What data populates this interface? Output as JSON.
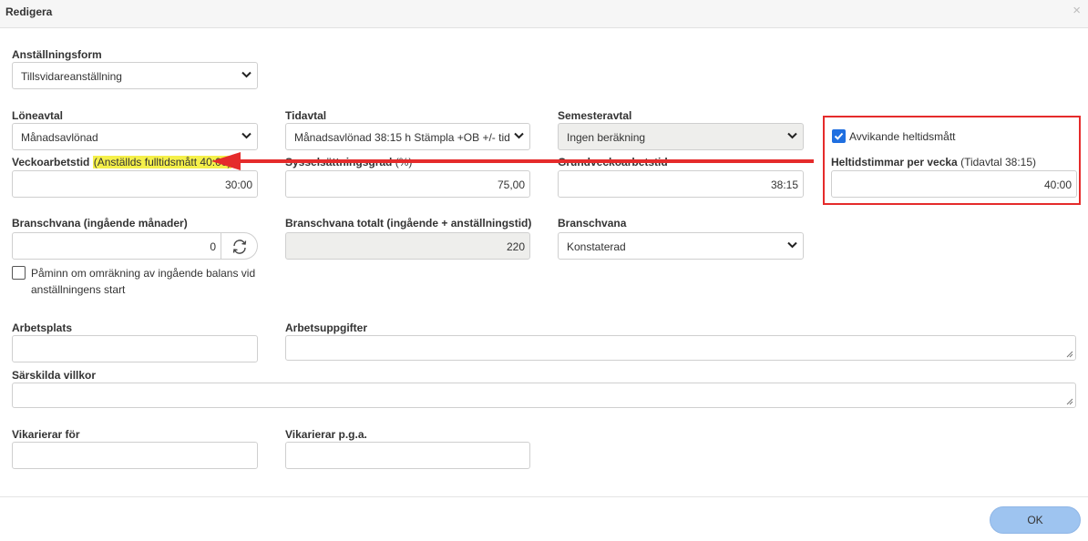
{
  "dialog": {
    "title": "Redigera",
    "close_icon": "×"
  },
  "employment_form": {
    "label": "Anställningsform",
    "value": "Tillsvidareanställning"
  },
  "salary_agreement": {
    "label": "Löneavtal",
    "value": "Månadsavlönad"
  },
  "time_agreement": {
    "label": "Tidavtal",
    "value": "Månadsavlönad 38:15 h Stämpla +OB +/- tid"
  },
  "vacation_agreement": {
    "label": "Semesteravtal",
    "value": "Ingen beräkning"
  },
  "weekly_hours": {
    "label": "Veckoarbetstid",
    "highlight": "(Anställds fulltidsmått 40:00)",
    "value": "30:00"
  },
  "employment_rate": {
    "label": "Sysselsättningsgrad",
    "suffix": "(%)",
    "value": "75,00"
  },
  "base_weekly_hours": {
    "label": "Grundveckoarbetstid",
    "value": "38:15"
  },
  "deviating_fulltime": {
    "checkbox_label": "Avvikande heltidsmått",
    "checked": true
  },
  "fulltime_hours": {
    "label": "Heltidstimmar per vecka",
    "sub": "(Tidavtal 38:15)",
    "value": "40:00"
  },
  "industry_experience": {
    "label": "Branschvana (ingående månader)",
    "value": "0",
    "icon": "refresh-icon"
  },
  "industry_total": {
    "label": "Branschvana totalt (ingående + anställningstid)",
    "value": "220"
  },
  "industry": {
    "label": "Branschvana",
    "value": "Konstaterad"
  },
  "reminder": {
    "line1": "Påminn om omräkning av ingående balans vid",
    "line2": "anställningens start",
    "checked": false
  },
  "workplace": {
    "label": "Arbetsplats",
    "value": ""
  },
  "tasks": {
    "label": "Arbetsuppgifter",
    "value": ""
  },
  "special_terms": {
    "label": "Särskilda villkor",
    "value": ""
  },
  "substitute_for": {
    "label": "Vikarierar för",
    "value": ""
  },
  "substitute_reason": {
    "label": "Vikarierar p.g.a.",
    "value": ""
  },
  "footer": {
    "ok_label": "OK"
  },
  "colors": {
    "annotation_red": "#e52b2b",
    "highlight_yellow": "#f5f04a",
    "ok_blue": "#9ec4f0",
    "checkbox_blue": "#1f6fe0"
  }
}
